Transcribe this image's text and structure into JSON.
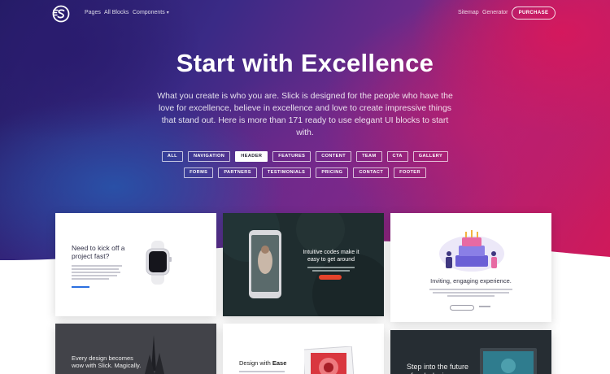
{
  "nav": {
    "links": [
      "Pages",
      "All Blocks",
      "Components"
    ],
    "right_links": [
      "Sitemap",
      "Generator"
    ],
    "purchase": "PURCHASE"
  },
  "hero": {
    "title_light": "Start with ",
    "title_bold": "Excellence",
    "subtitle": "What you create is who you are. Slick is designed for the people who have the love for excellence, believe in excellence and love to create impressive things that stand out. Here is more than 171 ready to use elegant UI blocks to start with."
  },
  "filters": {
    "active": "HEADER",
    "row1": [
      "ALL",
      "NAVIGATION",
      "HEADER",
      "FEATURES",
      "CONTENT",
      "TEAM",
      "CTA",
      "GALLERY"
    ],
    "row2": [
      "FORMS",
      "PARTNERS",
      "TESTIMONIALS",
      "PRICING",
      "CONTACT",
      "FOOTER"
    ]
  },
  "cards": {
    "card1_heading": "Need to kick off a project fast?",
    "card2_heading": "Intuitive codes make it easy to get around",
    "card3_heading": "Inviting, engaging experience.",
    "card4_heading": "Every design becomes wow with Slick. Magically.",
    "card5_heading_light": "Design with ",
    "card5_heading_bold": "Ease",
    "card6_heading": "Step into the future of web design"
  },
  "colors": {
    "accent_red": "#e5432b",
    "hero_blue": "#2a3b8f",
    "hero_pink": "#d0195a",
    "dark_text": "#232233"
  },
  "icons": [
    "slick-logo-icon",
    "chevron-down-icon",
    "smartwatch-illustration",
    "phone-photo",
    "birthday-cake-illustration",
    "cathedral-photo",
    "laptop-photo"
  ]
}
